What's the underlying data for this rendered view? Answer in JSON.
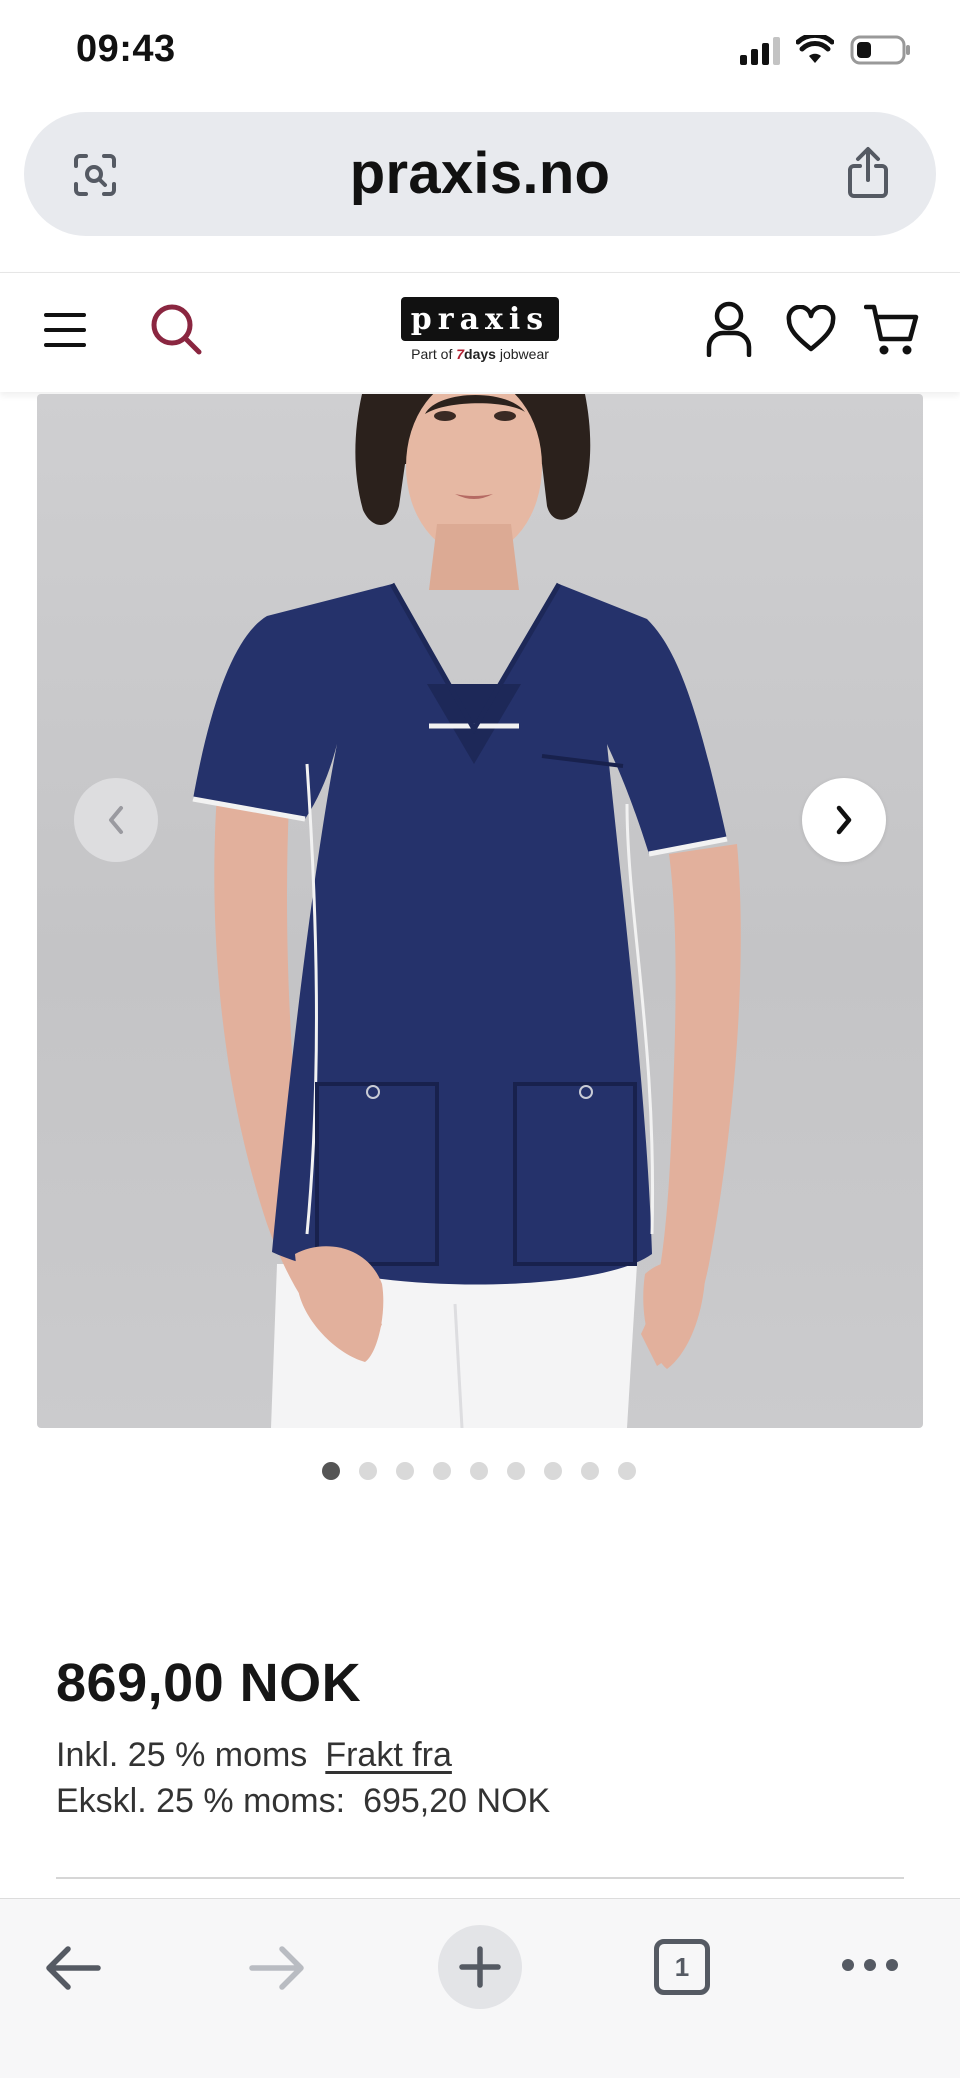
{
  "status_bar": {
    "time": "09:43"
  },
  "browser": {
    "url": "praxis.no",
    "tab_count": "1"
  },
  "site_header": {
    "logo_text": "praxis",
    "logo_sub_prefix": "Part of",
    "logo_sub_brand_num": "7",
    "logo_sub_brand_word": "days",
    "logo_sub_suffix": "jobwear",
    "accent_color": "#8a2640",
    "icons": [
      "menu-icon",
      "search-icon",
      "account-icon",
      "heart-icon",
      "cart-icon"
    ]
  },
  "gallery": {
    "image_count": 9,
    "active_index": 0,
    "product_color": "#25326b"
  },
  "product": {
    "price": "869,00 NOK",
    "vat_incl_label": "Inkl. 25 % moms",
    "freight_link": "Frakt fra",
    "vat_excl_label": "Ekskl. 25 % moms:",
    "vat_excl_value": "695,20 NOK"
  }
}
